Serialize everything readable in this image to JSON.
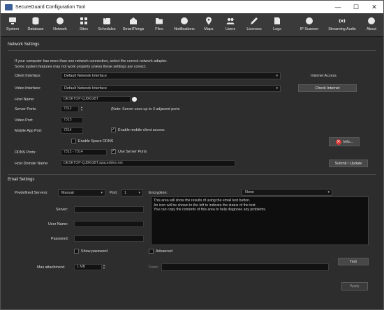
{
  "window": {
    "title": "SecureGuard Configuration Tool",
    "controls": [
      "—",
      "☐",
      "✕"
    ]
  },
  "toolbar": {
    "items": [
      {
        "label": "System",
        "icon": "system-icon"
      },
      {
        "label": "Database",
        "icon": "database-icon"
      },
      {
        "label": "Network",
        "icon": "network-icon"
      },
      {
        "label": "Sites",
        "icon": "sites-icon"
      },
      {
        "label": "Schedules",
        "icon": "schedules-icon"
      },
      {
        "label": "SmartThings",
        "icon": "smartthings-icon"
      },
      {
        "label": "Files",
        "icon": "files-icon"
      },
      {
        "label": "Notifications",
        "icon": "notifications-icon"
      },
      {
        "label": "Maps",
        "icon": "maps-icon"
      },
      {
        "label": "Users",
        "icon": "users-icon"
      },
      {
        "label": "Licenses",
        "icon": "licenses-icon"
      },
      {
        "label": "Logs",
        "icon": "logs-icon"
      },
      {
        "label": "IP Scanner",
        "icon": "ip-scanner-icon"
      },
      {
        "label": "Streaming Audio",
        "icon": "streaming-audio-icon"
      },
      {
        "label": "About",
        "icon": "about-icon"
      }
    ]
  },
  "network": {
    "section_title": "Network Settings",
    "note_line1": "If your computer has more than one network connection, select the correct network adapter.",
    "note_line2": "Some system features may not work properly unless these settings are correct.",
    "client_interface_label": "Client Interface:",
    "client_interface_value": "Default Network Interface",
    "video_interface_label": "Video Interface:",
    "video_interface_value": "Default Network Interface",
    "internet_access_label": "Internet Access",
    "check_internet_label": "Check Internet",
    "host_name_label": "Host Name:",
    "host_name_value": "DESKTOP-QJ8KGBT",
    "server_ports_label": "Server Ports:",
    "server_ports_value": "7312",
    "server_ports_note": "(Note: Server uses up to 3 adjacent ports",
    "video_port_label": "Video Port:",
    "video_port_value": "7313",
    "mobile_port_label": "Mobile App Port:",
    "mobile_port_value": "7314",
    "enable_mobile_label": "Enable mobile client access",
    "enable_ddns_label": "Enable Space DDNS",
    "info_label": "Info...",
    "ddns_ports_label": "DDNS Ports:",
    "ddns_ports_value": "7312 - 7314",
    "use_server_ports_label": "Use Server Ports",
    "host_domain_label": "Host Domain Name:",
    "host_domain_value": "DESKTOP-QJ8KGBT.spaceddns.net",
    "submit_update_label": "Submit / Update"
  },
  "email": {
    "section_title": "Email Settings",
    "predefined_label": "Predefined Servers:",
    "predefined_value": "Manual",
    "port_label": "Port:",
    "port_value": "1",
    "encryption_label": "Encryption:",
    "encryption_value": "None",
    "server_label": "Server:",
    "server_value": "",
    "username_label": "User Name:",
    "username_value": "",
    "password_label": "Password:",
    "password_value": "",
    "show_password_label": "Show password",
    "advanced_label": "Advanced",
    "result_line1": "This area will show the results of using the email test button.",
    "result_line2": "An icon will be shown to the left to indicate the status of the test.",
    "result_line3": "You can copy the contents of this area to help diagnose any problems.",
    "max_attachment_label": "Max attachment:",
    "max_attachment_value": "1 MB",
    "from_label": "From:",
    "from_value": "",
    "test_label": "Test",
    "apply_label": "Apply"
  },
  "colors": {
    "accent": "#3a5f98",
    "background": "#2d2d2d",
    "toolbar": "#3a3a3a",
    "info_icon": "#d83a3a"
  }
}
